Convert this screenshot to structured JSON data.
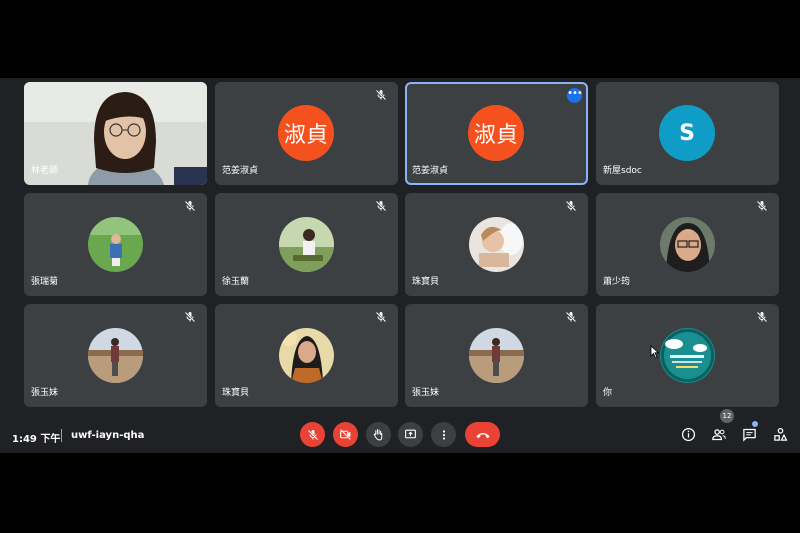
{
  "participants": [
    {
      "name": "林老師",
      "kind": "video",
      "muted": false
    },
    {
      "name": "范姜淑貞",
      "kind": "letter",
      "initials": "淑貞",
      "avatar_color": "#f4511e",
      "muted": true
    },
    {
      "name": "范姜淑貞",
      "kind": "letter",
      "initials": "淑貞",
      "avatar_color": "#f4511e",
      "muted": false,
      "active": true,
      "more_menu": "•••"
    },
    {
      "name": "新屋sdoc",
      "kind": "letter",
      "initials": "S",
      "avatar_color": "#0f9dc7",
      "muted": false
    },
    {
      "name": "張瑞菊",
      "kind": "photo",
      "muted": true
    },
    {
      "name": "徐玉蘭",
      "kind": "photo",
      "muted": true
    },
    {
      "name": "珠寶貝",
      "kind": "photo",
      "muted": true
    },
    {
      "name": "蕭少筠",
      "kind": "photo",
      "muted": true
    },
    {
      "name": "張玉妹",
      "kind": "photo",
      "muted": true
    },
    {
      "name": "珠寶貝",
      "kind": "photo",
      "muted": true
    },
    {
      "name": "張玉妹",
      "kind": "photo",
      "muted": true
    },
    {
      "name": "你",
      "kind": "photo",
      "muted": true
    }
  ],
  "bottom_bar": {
    "time": "1:49 下午",
    "meeting_code": "uwf-iayn-qha",
    "participant_count": "12",
    "controls": [
      "mic-off-icon",
      "camera-off-icon",
      "raise-hand-icon",
      "present-screen-icon",
      "more-vert-icon",
      "end-call-icon"
    ],
    "right_icons": [
      "info-icon",
      "people-icon",
      "chat-icon",
      "activities-icon"
    ]
  },
  "colors": {
    "background": "#202124",
    "tile": "#3c4043",
    "danger": "#ea4335",
    "active_border": "#8ab4f8"
  }
}
